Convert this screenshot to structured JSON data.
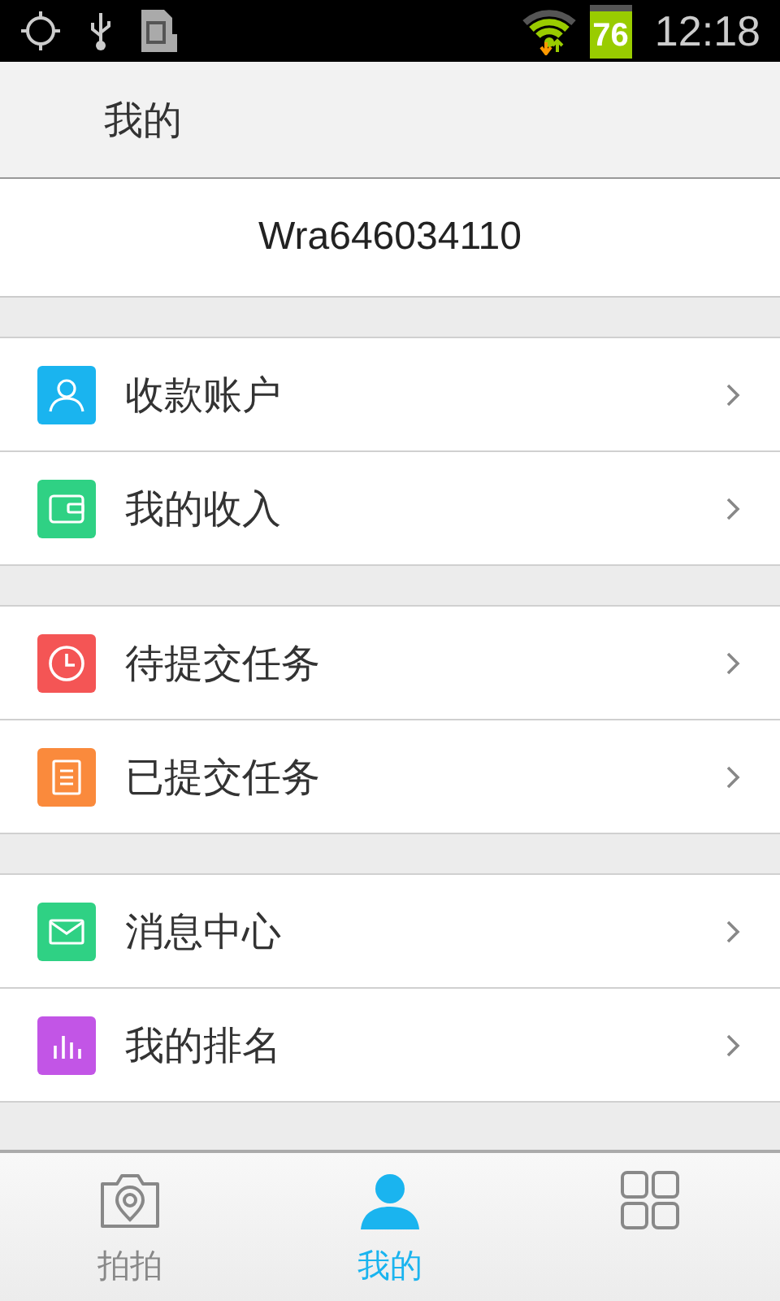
{
  "status_bar": {
    "battery": "76",
    "time": "12:18"
  },
  "header": {
    "title": "我的"
  },
  "account": {
    "username": "Wra646034110"
  },
  "groups": [
    [
      {
        "label": "收款账户",
        "kind": "person",
        "color": "#1ab4ef"
      },
      {
        "label": "我的收入",
        "kind": "wallet",
        "color": "#2fd184"
      }
    ],
    [
      {
        "label": "待提交任务",
        "kind": "clock",
        "color": "#f45555"
      },
      {
        "label": "已提交任务",
        "kind": "document",
        "color": "#fa8a3c"
      }
    ],
    [
      {
        "label": "消息中心",
        "kind": "envelope",
        "color": "#2fd184"
      },
      {
        "label": "我的排名",
        "kind": "bars",
        "color": "#c255e6"
      }
    ]
  ],
  "tabs": [
    {
      "label": "拍拍",
      "kind": "camera",
      "selected": false
    },
    {
      "label": "我的",
      "kind": "person",
      "selected": true
    },
    {
      "kind": "grid",
      "selected": false
    }
  ]
}
